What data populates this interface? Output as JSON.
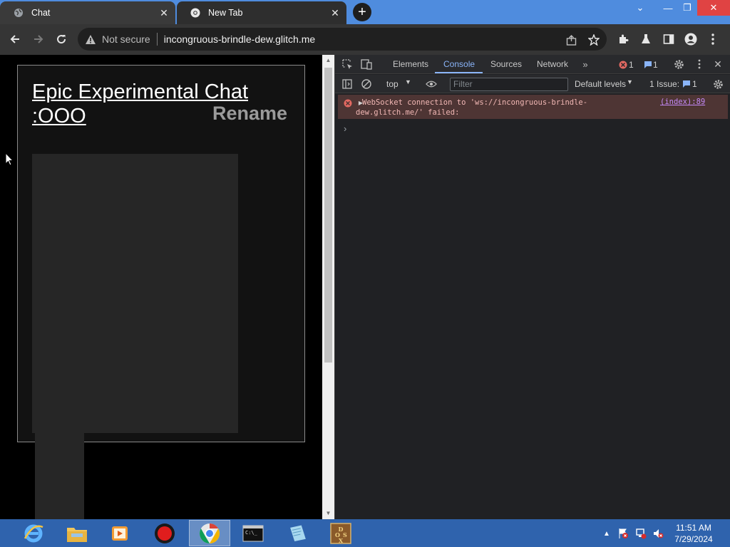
{
  "browser": {
    "tabs": [
      {
        "label": "Chat",
        "active": true
      },
      {
        "label": "New Tab",
        "active": false
      }
    ],
    "address": {
      "security_label": "Not secure",
      "url": "incongruous-brindle-dew.glitch.me"
    }
  },
  "page": {
    "chat_title": "Epic Experimental Chat :OOO",
    "rename_label": "Rename"
  },
  "devtools": {
    "tabs": [
      "Elements",
      "Console",
      "Sources",
      "Network"
    ],
    "active_tab": "Console",
    "error_count": "1",
    "message_count": "1",
    "context": "top",
    "filter_placeholder": "Filter",
    "levels_label": "Default levels",
    "issues_label": "1 Issue:",
    "issues_count": "1",
    "console_error": {
      "message": "WebSocket connection to 'ws://incongruous-brindle-dew.glitch.me/' failed:",
      "source": "(index):89"
    },
    "prompt": "›"
  },
  "taskbar": {
    "apps": [
      "internet-explorer",
      "file-explorer",
      "media-player",
      "screen-recorder",
      "chrome",
      "command-prompt",
      "notepad",
      "dosbox"
    ],
    "clock_time": "11:51 AM",
    "clock_date": "7/29/2024"
  },
  "colors": {
    "tabstrip": "#4f8cde",
    "toolbar": "#353535",
    "taskbar": "#2f63ad",
    "devtools_accent": "#8ab4f8",
    "error_bg": "#4e3534"
  }
}
